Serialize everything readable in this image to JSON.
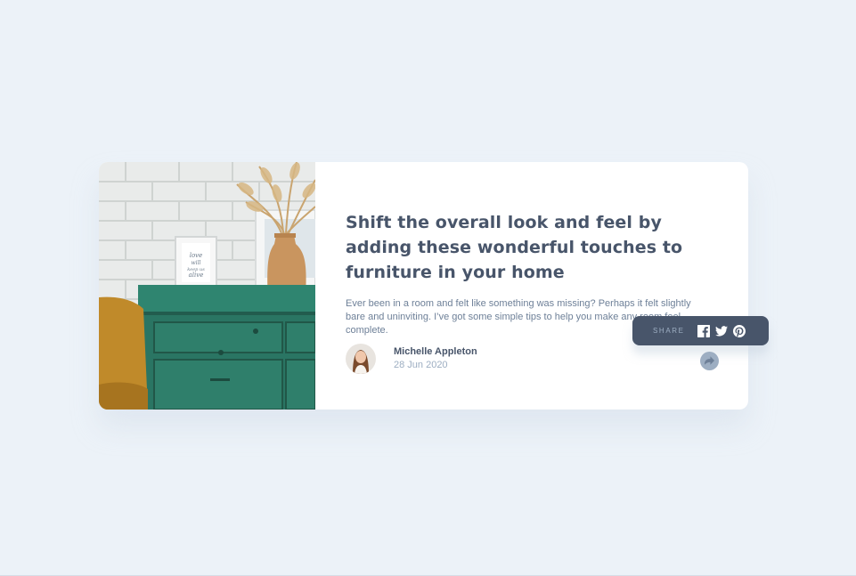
{
  "article": {
    "title": "Shift the overall look and feel by adding these wonderful touches to furniture in your home",
    "description": "Ever been in a room and felt like something was missing? Perhaps it felt slightly bare and uninviting. I’ve got some simple tips to help you make any room feel complete.",
    "image_alt": "drawers",
    "frame_text": "love will keep us alive"
  },
  "author": {
    "name": "Michelle Appleton",
    "date": "28 Jun 2020"
  },
  "share": {
    "label": "SHARE",
    "icons": [
      "facebook-icon",
      "twitter-icon",
      "pinterest-icon",
      "share-icon"
    ]
  },
  "colors": {
    "background": "#ecf2f8",
    "card": "#ffffff",
    "title": "#48556a",
    "text": "#6e8098",
    "muted": "#9daec2",
    "popup": "#48556a"
  }
}
